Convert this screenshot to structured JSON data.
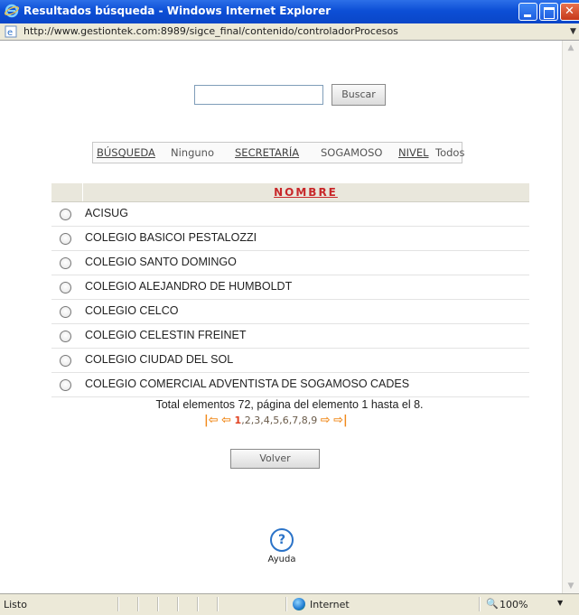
{
  "window": {
    "title": "Resultados búsqueda - Windows Internet Explorer",
    "url": "http://www.gestiontek.com:8989/sigce_final/contenido/controladorProcesos"
  },
  "search": {
    "value": "",
    "button_label": "Buscar"
  },
  "filters": [
    {
      "label": "BÚSQUEDA",
      "value": "Ninguno"
    },
    {
      "label": "SECRETARÍA",
      "value": "SOGAMOSO"
    },
    {
      "label": "NIVEL",
      "value": "Todos"
    }
  ],
  "table": {
    "header": "NOMBRE",
    "rows": [
      "ACISUG",
      "COLEGIO BASICOI PESTALOZZI",
      "COLEGIO SANTO DOMINGO",
      "COLEGIO ALEJANDRO DE HUMBOLDT",
      "COLEGIO CELCO",
      "COLEGIO CELESTIN FREINET",
      "COLEGIO CIUDAD DEL SOL",
      "COLEGIO COMERCIAL ADVENTISTA DE SOGAMOSO CADES"
    ]
  },
  "pagination": {
    "summary": "Total elementos 72, página del elemento 1 hasta el 8.",
    "current": "1",
    "pages": [
      ",2",
      ",3",
      ",4",
      ",5",
      ",6",
      ",7",
      ",8",
      ",9"
    ],
    "first_icon": "first-page-arrow",
    "prev_icon": "prev-page-arrow",
    "next_icon": "next-page-arrow",
    "last_icon": "last-page-arrow"
  },
  "back_button_label": "Volver",
  "help_label": "Ayuda",
  "statusbar": {
    "status": "Listo",
    "zone": "Internet",
    "zoom": "100%"
  },
  "colors": {
    "titlebar": "#0d4fd6",
    "header_text": "#c8282a",
    "pager_arrows": "#f08a1c"
  }
}
